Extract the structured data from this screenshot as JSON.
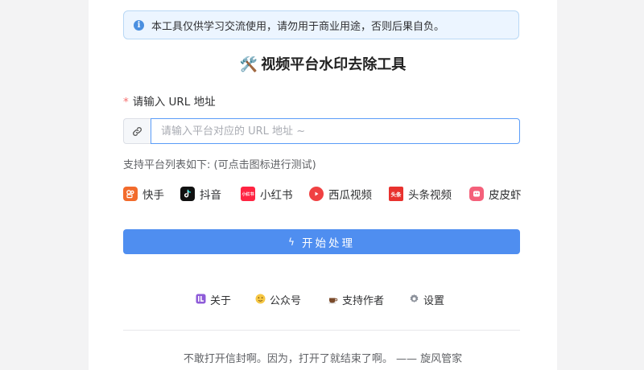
{
  "notice": {
    "icon": "info-icon",
    "text": "本工具仅供学习交流使用，请勿用于商业用途，否则后果自负。"
  },
  "title": {
    "emoji": "🛠️",
    "text": "视频平台水印去除工具"
  },
  "url_field": {
    "label": "请输入 URL 地址",
    "required_mark": "*",
    "prefix_icon": "link-icon",
    "placeholder": "请输入平台对应的 URL 地址 ~",
    "value": ""
  },
  "support_text": "支持平台列表如下: (可点击图标进行测试)",
  "platforms": [
    {
      "name": "快手",
      "icon": "kuaishou-icon",
      "color": "#f26b2c"
    },
    {
      "name": "抖音",
      "icon": "douyin-icon",
      "color": "#111111"
    },
    {
      "name": "小红书",
      "icon": "xiaohongshu-icon",
      "color": "#ff2442"
    },
    {
      "name": "西瓜视频",
      "icon": "xigua-icon",
      "color": "#f04142"
    },
    {
      "name": "头条视频",
      "icon": "toutiao-icon",
      "color": "#e8322e"
    },
    {
      "name": "皮皮虾",
      "icon": "pipixia-icon",
      "color": "#f4607a"
    }
  ],
  "start_button": {
    "icon": "bolt-icon",
    "label": "开始处理",
    "color": "#4f8ef0"
  },
  "footer_links": [
    {
      "label": "关于",
      "icon": "about-icon"
    },
    {
      "label": "公众号",
      "icon": "wechat-emoji-icon"
    },
    {
      "label": "支持作者",
      "icon": "coffee-icon"
    },
    {
      "label": "设置",
      "icon": "gear-icon"
    }
  ],
  "quote": "不敢打开信封啊。因为，打开了就结束了啊。 —— 旋风管家"
}
